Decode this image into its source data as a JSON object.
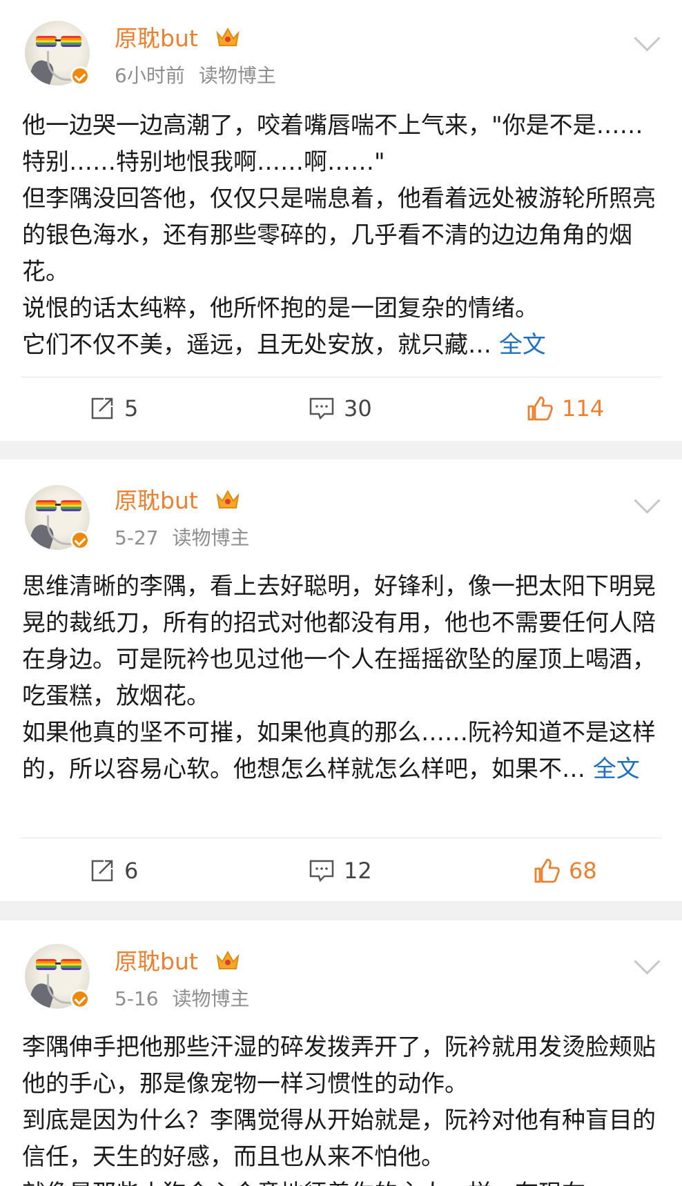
{
  "posts": [
    {
      "author": "原耽but",
      "time": "6小时前",
      "tag": "读物博主",
      "lines": [
        "他一边哭一边高潮了，咬着嘴唇喘不上气来，\"你是不是……特别……特别地恨我啊……啊……\"",
        "但李隅没回答他，仅仅只是喘息着，他看着远处被游轮所照亮的银色海水，还有那些零碎的，几乎看不清的边边角角的烟花。",
        "说恨的话太纯粹，他所怀抱的是一团复杂的情绪。",
        "它们不仅不美，遥远，且无处安放，就只藏…"
      ],
      "more": "全文",
      "reposts": "5",
      "comments": "30",
      "likes": "114"
    },
    {
      "author": "原耽but",
      "time": "5-27",
      "tag": "读物博主",
      "lines": [
        "思维清晰的李隅，看上去好聪明，好锋利，像一把太阳下明晃晃的裁纸刀，所有的招式对他都没有用，他也不需要任何人陪在身边。可是阮衿也见过他一个人在摇摇欲坠的屋顶上喝酒，吃蛋糕，放烟花。",
        "如果他真的坚不可摧，如果他真的那么……阮衿知道不是这样的，所以容易心软。他想怎么样就怎么样吧，如果不…"
      ],
      "more": "全文",
      "reposts": "6",
      "comments": "12",
      "likes": "68"
    },
    {
      "author": "原耽but",
      "time": "5-16",
      "tag": "读物博主",
      "lines": [
        "李隅伸手把他那些汗湿的碎发拨弄开了，阮衿就用发烫脸颊贴他的手心，那是像宠物一样习惯性的动作。",
        "到底是因为什么？李隅觉得从开始就是，阮衿对他有种盲目的信任，天生的好感，而且也从来不怕他。",
        "就像是那些小狗会心会意地惩着你的主人一样，有现在"
      ],
      "more": "",
      "reposts": "",
      "comments": "",
      "likes": ""
    }
  ]
}
